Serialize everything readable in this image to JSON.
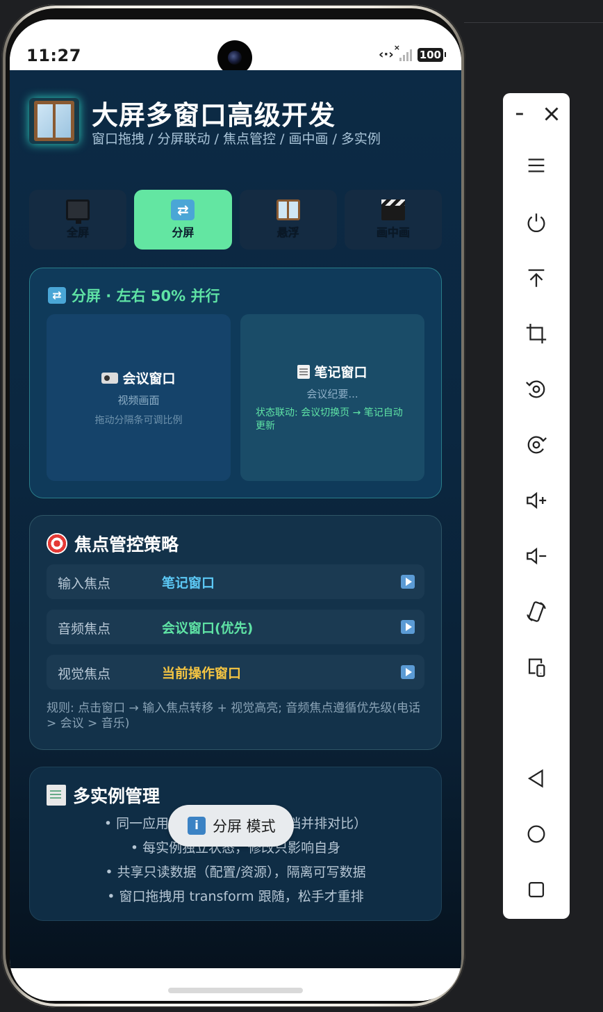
{
  "status_bar": {
    "time": "11:27",
    "battery": "100",
    "signal_mark": "×"
  },
  "header": {
    "title": "大屏多窗口高级开发",
    "subtitle": "窗口拖拽 / 分屏联动 / 焦点管控 / 画中画 / 多实例"
  },
  "tabs": [
    {
      "label": "全屏",
      "icon": "monitor-icon",
      "active": false
    },
    {
      "label": "分屏",
      "icon": "shuffle-icon",
      "active": true
    },
    {
      "label": "悬浮",
      "icon": "window-icon",
      "active": false
    },
    {
      "label": "画中画",
      "icon": "clapper-icon",
      "active": false
    }
  ],
  "split_card": {
    "title": "分屏 · 左右 50% 并行",
    "left_pane": {
      "title": "会议窗口",
      "subtitle": "视频画面",
      "hint": "拖动分隔条可调比例"
    },
    "right_pane": {
      "title": "笔记窗口",
      "subtitle": "会议纪要...",
      "sync": "状态联动: 会议切换页 → 笔记自动更新"
    }
  },
  "focus_card": {
    "title": "焦点管控策略",
    "rows": [
      {
        "key": "输入焦点",
        "value": "笔记窗口",
        "color": "#5cc8f5"
      },
      {
        "key": "音频焦点",
        "value": "会议窗口(优先)",
        "color": "#5fe3a5"
      },
      {
        "key": "视觉焦点",
        "value": "当前操作窗口",
        "color": "#f5c542"
      }
    ],
    "rule": "规则: 点击窗口 → 输入焦点转移 + 视觉高亮; 音频焦点遵循优先级(电话 > 会议 > 音乐)"
  },
  "multi_card": {
    "title": "多实例管理",
    "items": [
      "同一应用开多个窗口（两个文档并排对比）",
      "每实例独立状态，修改只影响自身",
      "共享只读数据（配置/资源），隔离可写数据",
      "窗口拖拽用 transform 跟随，松手才重排"
    ]
  },
  "toast": {
    "text": "分屏 模式"
  },
  "toolbar": {
    "items": [
      "minimize",
      "close",
      "menu",
      "power",
      "move-to-top",
      "crop",
      "rotate-left",
      "rotate-right",
      "volume-up",
      "volume-down",
      "rotate-device",
      "device-mirror",
      "back",
      "home",
      "recents"
    ]
  }
}
